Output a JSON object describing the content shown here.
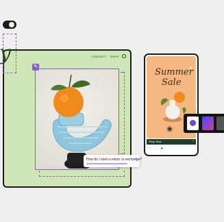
{
  "site": {
    "nav": [
      "CONTACT",
      "SHOP"
    ],
    "script_glyph": "y"
  },
  "chat": {
    "text": "How do I start a return or exchange?"
  },
  "phone": {
    "headline_line1": "Summer",
    "headline_line2": "Sale",
    "cta": "Shop Now"
  },
  "colors": {
    "site_bg": "#cfe6b6",
    "selection_accent": "#8a5bd0",
    "phone_bg": "#f6b883",
    "cta_bar": "#1d3f2c"
  }
}
